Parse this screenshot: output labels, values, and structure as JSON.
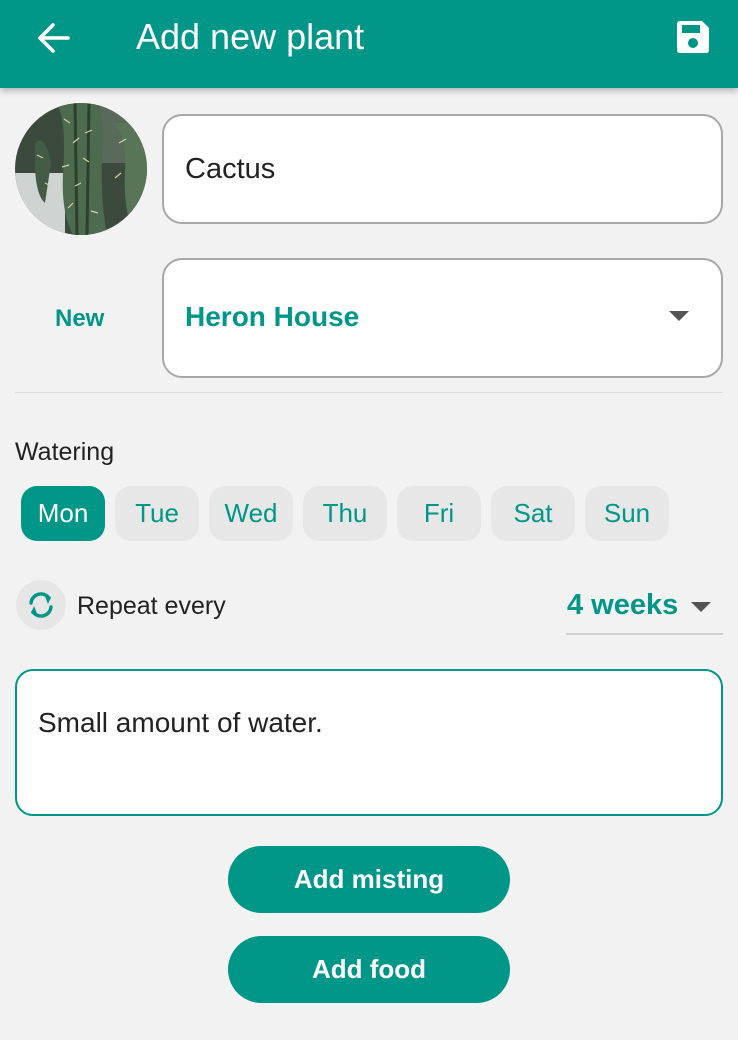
{
  "appbar": {
    "title": "Add new plant",
    "back_icon": "arrow-left-icon",
    "save_icon": "floppy-disk-save-icon",
    "color": "#009688"
  },
  "plant": {
    "photo": "cactus-photo",
    "name": "Cactus"
  },
  "location": {
    "new_label": "New",
    "selected": "Heron House"
  },
  "watering": {
    "label": "Watering",
    "days": [
      {
        "label": "Mon",
        "selected": true
      },
      {
        "label": "Tue",
        "selected": false
      },
      {
        "label": "Wed",
        "selected": false
      },
      {
        "label": "Thu",
        "selected": false
      },
      {
        "label": "Fri",
        "selected": false
      },
      {
        "label": "Sat",
        "selected": false
      },
      {
        "label": "Sun",
        "selected": false
      }
    ],
    "repeat_icon": "repeat-sync-icon",
    "repeat_label": "Repeat every",
    "interval": "4 weeks",
    "notes": "Small amount of water."
  },
  "actions": {
    "add_misting": "Add misting",
    "add_food": "Add food"
  },
  "colors": {
    "accent": "#009688",
    "background": "#f2f2f2",
    "chip": "#e7e7e7"
  }
}
